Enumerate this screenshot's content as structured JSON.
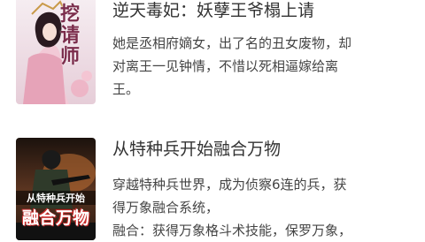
{
  "books": [
    {
      "title": "逆天毒妃：妖孽王爷榻上请",
      "description_lines": [
        "她是丞相府嫡女，出了名的丑女废物，却",
        "对离王一见钟情，不惜以死相逼嫁给离",
        "王。"
      ],
      "cover": {
        "title_text": "挖请师",
        "palette": [
          "#f4e9ef",
          "#d98aa2",
          "#7b2d4c"
        ]
      }
    },
    {
      "title": "从特种兵开始融合万物",
      "description_lines": [
        "穿越特种兵世界，成为侦察6连的兵，获",
        "得万象融合系统，",
        "融合：获得万象格斗术技能，保罗万象，"
      ],
      "cover": {
        "banner_text": "从特种兵开始",
        "title_text": "融合万物",
        "palette": [
          "#2b1a12",
          "#b86a32",
          "#c92b2b"
        ]
      }
    }
  ]
}
